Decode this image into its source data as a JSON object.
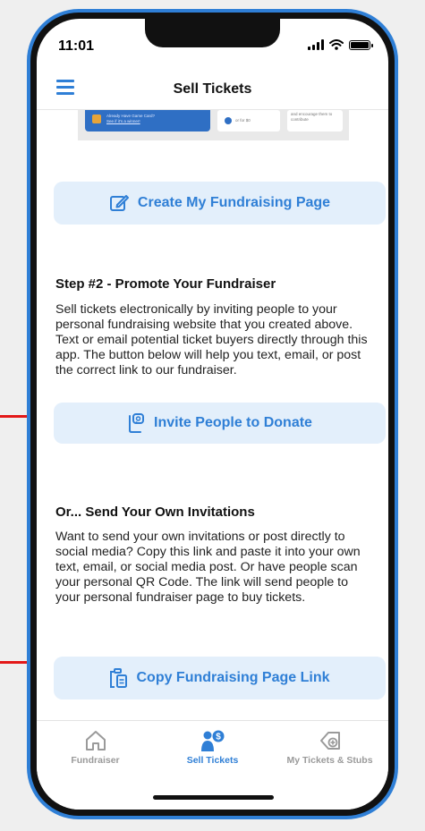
{
  "status_bar": {
    "time": "11:01"
  },
  "header": {
    "title": "Sell Tickets"
  },
  "preview": {
    "line1": "Already Have Game Card?",
    "line2": "See if it's a winner!",
    "line3": "or for $0",
    "line4": "and encourage them to",
    "line5": "contribute"
  },
  "buttons": {
    "create_page": "Create My Fundraising Page",
    "invite": "Invite People to Donate",
    "copy_link": "Copy Fundraising Page Link"
  },
  "step2": {
    "heading": "Step #2 - Promote Your Fundraiser",
    "body": "Sell tickets electronically by inviting people to your personal fundraising website that you created above. Text or email potential ticket buyers directly through this app. The button below will help you text, email, or post the correct link to our fundraiser."
  },
  "own_invites": {
    "heading": "Or... Send Your Own Invitations",
    "body": "Want to send your own invitations or post directly to social media? Copy this link and paste it into your own text, email, or social media post. Or have people scan your personal QR Code. The link will send people to your personal fundraiser page to buy tickets."
  },
  "tabs": [
    {
      "label": "Fundraiser",
      "icon": "home-icon",
      "active": false
    },
    {
      "label": "Sell Tickets",
      "icon": "person-dollar-icon",
      "active": true
    },
    {
      "label": "My Tickets & Stubs",
      "icon": "tag-add-icon",
      "active": false
    }
  ],
  "colors": {
    "accent": "#2f7fd6",
    "button_bg": "#e3effb",
    "annotation_arrow": "#e31818",
    "phone_frame": "#2f7fd6"
  }
}
